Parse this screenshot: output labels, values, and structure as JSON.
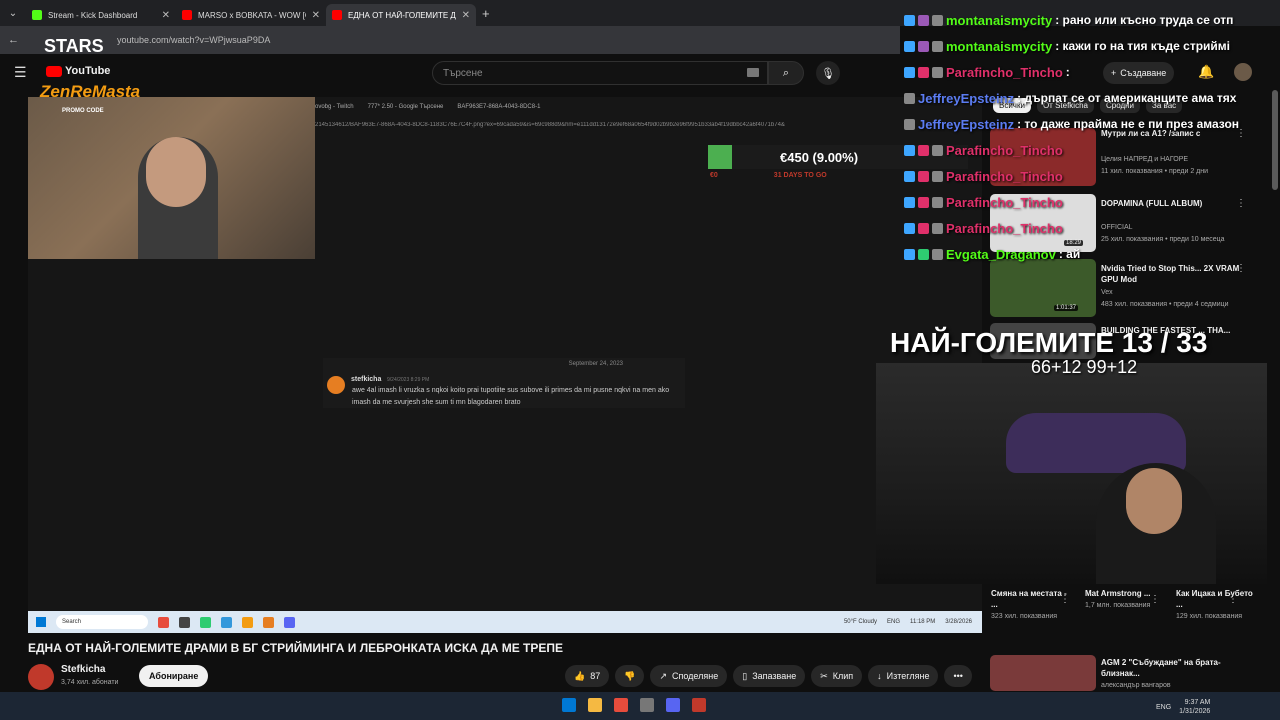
{
  "browser": {
    "tabs": [
      {
        "title": "Stream - Kick Dashboard",
        "color": "#53fc18"
      },
      {
        "title": "MARSO x BOBKATA - WOW [OF",
        "color": "#ff0000"
      },
      {
        "title": "ЕДНА ОТ НАЙ-ГОЛЕМИТЕ ДРАМ",
        "color": "#ff0000"
      }
    ],
    "url": "youtube.com/watch?v=WPjwsuaP9DA"
  },
  "youtube": {
    "logo": "YouTube",
    "logo_region": "BG",
    "search_placeholder": "Търсене",
    "create_label": "Създаване"
  },
  "overlay_brand": {
    "stars": "STARS",
    "zenremasta": "ZenReMasta",
    "promo": "PROMO CODE"
  },
  "inner_screen": {
    "tabs": [
      "ovobg - Twitch",
      "777* 2.50 - Google Търсене",
      "BAF963E7-868A-4043-8DC8-1"
    ],
    "url": "2145134612/BAF963E7-868A-4043-8DC8-1183C76E7C4F.png?ex=69cada59&is=69c988d9&hm=e111dd13172e9ef68a0654f9d02b9b2e96f9951b33ab4f19dbbc42a6f4071b74&",
    "donation_amount": "€450 (9.00%)",
    "donation_left": "€0",
    "donation_right": "31 DAYS TO GO",
    "chat_date": "September 24, 2023",
    "chat_name": "stefkicha",
    "chat_time": "9/24/2023 8:29 PM",
    "chat_message": "awe 4al imash li vruzka s nqkoi koito prai tupotiite sus subove ili primes da mi pusne nqkvi na men ako imash da me svurjesh she sum ti mn blagodaren brato",
    "taskbar_search": "Search",
    "weather": "50°F Cloudy",
    "lang": "ENG",
    "time": "11:18 PM",
    "date": "3/28/2026"
  },
  "video": {
    "title": "ЕДНА ОТ НАЙ-ГОЛЕМИТЕ ДРАМИ В БГ СТРИЙМИНГА И ЛЕБРОНКАТА ИСКА ДА МЕ ТРЕПЕ",
    "channel": "Stefkicha",
    "subscribers": "3,74 хил. абонати",
    "subscribe_label": "Абониране",
    "likes": "87",
    "share_label": "Споделяне",
    "save_label": "Запазване",
    "clip_label": "Клип",
    "download_label": "Изтегляне"
  },
  "chips": [
    "Всички",
    "От Stefkicha",
    "Сродни",
    "За вас"
  ],
  "recommendations": [
    {
      "title": "Мутри ли са А1? /запис с",
      "channel": "",
      "meta": "",
      "duration": ""
    },
    {
      "title": "",
      "channel": "Целия НАПРЕД и НАГОРЕ",
      "meta": "11 хил. показвания • преди 2 дни",
      "duration": ""
    },
    {
      "title": "DOPAMINA (FULL ALBUM)",
      "channel": "OFFICIAL",
      "meta": "25 хил. показвания • преди 10 месеца",
      "duration": "18:29"
    },
    {
      "title": "Nvidia Tried to Stop This... 2X VRAM GPU Mod",
      "channel": "Vex",
      "meta": "483 хил. показвания • преди 4 седмици",
      "duration": "1:01:37"
    },
    {
      "title": "BUILDING THE FASTEST ... ТНА...",
      "channel": "",
      "meta": "",
      "duration": ""
    }
  ],
  "chat": [
    {
      "name": "montanaismycity",
      "msg": ": рано или късно труда се отп",
      "color": "#53fc18"
    },
    {
      "name": "montanaismycity",
      "msg": ": кажи го на тия къде стриймі",
      "color": "#53fc18"
    },
    {
      "name": "Parafincho_Tincho",
      "msg": ":",
      "color": "#e0306a"
    },
    {
      "name": "JeffreyEpsteinz",
      "msg": ": дърпат се от американците ама тях",
      "color": "#5b7cf2"
    },
    {
      "name": "JeffreyEpsteinz",
      "msg": ": то даже прайма не е пи през амазон",
      "color": "#5b7cf2"
    },
    {
      "name": "Parafincho_Tincho",
      "msg": "",
      "color": "#e0306a"
    },
    {
      "name": "Parafincho_Tincho",
      "msg": "",
      "color": "#e0306a"
    },
    {
      "name": "Parafincho_Tincho",
      "msg": "",
      "color": "#e0306a"
    },
    {
      "name": "Parafincho_Tincho",
      "msg": "",
      "color": "#e0306a"
    },
    {
      "name": "Evgata_Draganov",
      "msg": ": ай",
      "color": "#53fc18"
    }
  ],
  "counter": {
    "label": "НАЙ-ГОЛЕМИТЕ 13 / 33",
    "sub": "66+12 99+12"
  },
  "bottom_recs": [
    {
      "title": "Смяна на местата - ...",
      "meta": "323 хил. показвания"
    },
    {
      "title": "Mat Armstrong ...",
      "meta": "1,7 млн. показвания"
    },
    {
      "title": "Как Ицака и Бубето ...",
      "meta": "129 хил. показвания"
    }
  ],
  "rec_last": {
    "title": "AGM 2 \"Събуждане\" на брата-близнак...",
    "channel": "александър вангаров"
  },
  "windows": {
    "lang": "ENG",
    "time": "9:37 AM",
    "date": "1/31/2026"
  }
}
